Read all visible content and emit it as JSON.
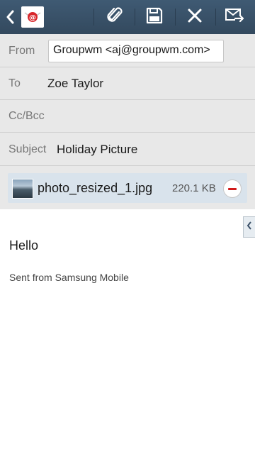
{
  "toolbar": {
    "back_icon": "chevron-left-icon",
    "app_icon": "email-app-icon",
    "actions": [
      {
        "icon": "paperclip-icon",
        "name": "attach"
      },
      {
        "icon": "save-icon",
        "name": "save"
      },
      {
        "icon": "close-icon",
        "name": "discard"
      },
      {
        "icon": "send-icon",
        "name": "send"
      }
    ],
    "accent_color": "#3a5068"
  },
  "compose": {
    "from_label": "From",
    "from_value": "Groupwm <aj@groupwm.com>",
    "to_label": "To",
    "to_value": "Zoe Taylor",
    "ccbcc_label": "Cc/Bcc",
    "subject_label": "Subject",
    "subject_value": "Holiday Picture"
  },
  "attachment": {
    "name": "photo_resized_1.jpg",
    "size": "220.1 KB",
    "remove_icon": "remove-circle-icon"
  },
  "body": {
    "greeting": "Hello",
    "signature": "Sent from Samsung Mobile"
  }
}
